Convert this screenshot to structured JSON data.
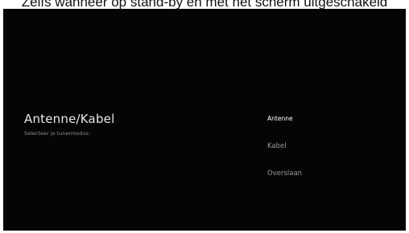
{
  "caption": "Zelfs wanneer op stand-by en met het scherm uitgeschakeld",
  "setup": {
    "title": "Antenne/Kabel",
    "subtitle": "Selecteer je tunermodus:",
    "options": [
      {
        "label": "Antenne",
        "selected": true
      },
      {
        "label": "Kabel",
        "selected": false
      },
      {
        "label": "Overslaan",
        "selected": false
      }
    ]
  }
}
